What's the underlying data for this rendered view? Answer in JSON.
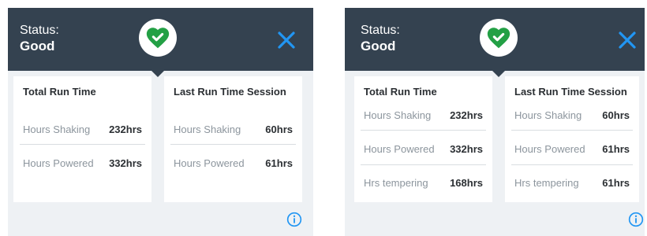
{
  "colors": {
    "header_bg": "#344250",
    "panel_bg": "#eef1f4",
    "card_bg": "#ffffff",
    "accent_blue": "#2196f3",
    "status_green": "#23a045"
  },
  "icons": {
    "status": "heart-check-icon",
    "close": "close-icon",
    "info": "info-icon"
  },
  "panels": [
    {
      "status_label": "Status:",
      "status_value": "Good",
      "cards": [
        {
          "title": "Total Run Time",
          "rows": [
            {
              "label": "Hours Shaking",
              "value": "232hrs"
            },
            {
              "label": "Hours Powered",
              "value": "332hrs"
            }
          ]
        },
        {
          "title": "Last Run Time Session",
          "rows": [
            {
              "label": "Hours Shaking",
              "value": "60hrs"
            },
            {
              "label": "Hours Powered",
              "value": "61hrs"
            }
          ]
        }
      ]
    },
    {
      "status_label": "Status:",
      "status_value": "Good",
      "cards": [
        {
          "title": "Total Run Time",
          "rows": [
            {
              "label": "Hours Shaking",
              "value": "232hrs"
            },
            {
              "label": "Hours Powered",
              "value": "332hrs"
            },
            {
              "label": "Hrs tempering",
              "value": "168hrs"
            }
          ]
        },
        {
          "title": "Last Run Time Session",
          "rows": [
            {
              "label": "Hours Shaking",
              "value": "60hrs"
            },
            {
              "label": "Hours Powered",
              "value": "61hrs"
            },
            {
              "label": "Hrs tempering",
              "value": "61hrs"
            }
          ]
        }
      ]
    }
  ]
}
